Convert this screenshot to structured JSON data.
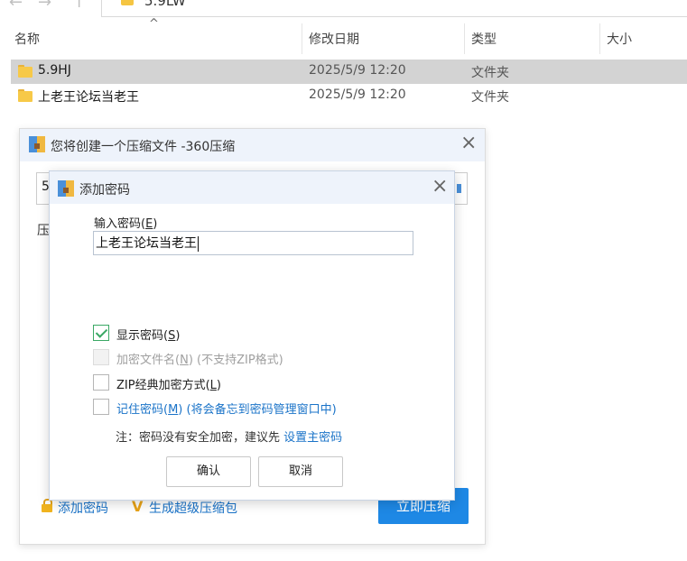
{
  "explorer": {
    "path": "5.9LW",
    "columns": {
      "name": "名称",
      "modified": "修改日期",
      "type": "类型",
      "size": "大小"
    },
    "rows": [
      {
        "name": "5.9HJ",
        "modified": "2025/5/9 12:20",
        "type": "文件夹"
      },
      {
        "name": "上老王论坛当老王",
        "modified": "2025/5/9 12:20",
        "type": "文件夹"
      }
    ]
  },
  "compress_dialog": {
    "title": "您将创建一个压缩文件 -360压缩",
    "field_fragment": "5",
    "label_fragment": "压",
    "add_password": "添加密码",
    "super_package": "生成超级压缩包",
    "start_button": "立即压缩"
  },
  "password_dialog": {
    "title": "添加密码",
    "input_label": "输入密码(",
    "input_label_key": "E",
    "input_label_end": ")",
    "password_value": "上老王论坛当老王",
    "options": {
      "show_password": {
        "label": "显示密码(",
        "key": "S",
        "end": ")",
        "checked": true
      },
      "encrypt_filename": {
        "label": "加密文件名(",
        "key": "N",
        "end": ") (不支持ZIP格式)",
        "checked": false
      },
      "zip_classic": {
        "label": "ZIP经典加密方式(",
        "key": "L",
        "end": ")",
        "checked": false
      },
      "remember_password": {
        "label": "记住密码(",
        "key": "M",
        "end": ") (将会备忘到密码管理窗口中)",
        "checked": false
      }
    },
    "note_prefix": "注：密码没有安全加密，建议先 ",
    "note_link": "设置主密码",
    "ok_button": "确认",
    "cancel_button": "取消"
  },
  "colors": {
    "accent": "#1e88e5",
    "link": "#1a73c8",
    "check": "#3aa864",
    "selection": "#d3d3d3"
  }
}
